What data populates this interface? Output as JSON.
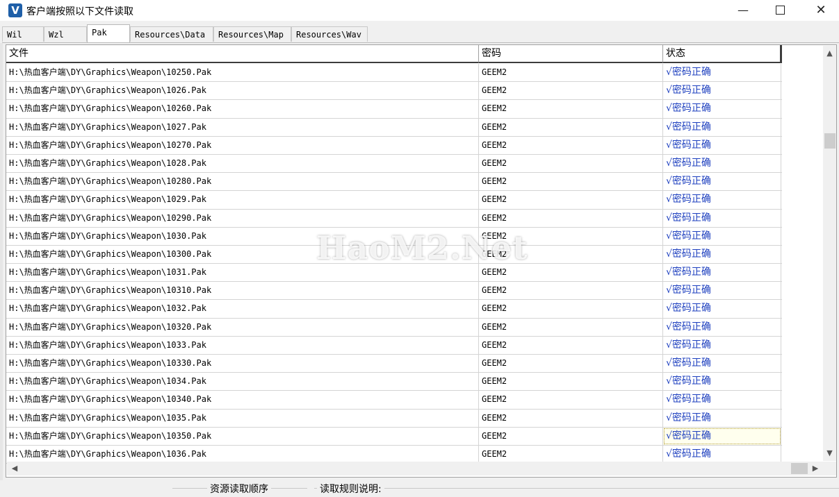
{
  "window": {
    "title": "客户端按照以下文件读取",
    "icon_letter": "V",
    "minimize": "—",
    "close": "✕"
  },
  "tabs": [
    {
      "label": "Wil",
      "active": false
    },
    {
      "label": "Wzl",
      "active": false
    },
    {
      "label": "Pak",
      "active": true
    },
    {
      "label": "Resources\\Data",
      "active": false
    },
    {
      "label": "Resources\\Map",
      "active": false
    },
    {
      "label": "Resources\\Wav",
      "active": false
    }
  ],
  "table": {
    "columns": [
      "文件",
      "密码",
      "状态"
    ],
    "rows": [
      {
        "file": "H:\\热血客户端\\DY\\Graphics\\Weapon\\10250.Pak",
        "password": "GEEM2",
        "status": "√密码正确"
      },
      {
        "file": "H:\\热血客户端\\DY\\Graphics\\Weapon\\1026.Pak",
        "password": "GEEM2",
        "status": "√密码正确"
      },
      {
        "file": "H:\\热血客户端\\DY\\Graphics\\Weapon\\10260.Pak",
        "password": "GEEM2",
        "status": "√密码正确"
      },
      {
        "file": "H:\\热血客户端\\DY\\Graphics\\Weapon\\1027.Pak",
        "password": "GEEM2",
        "status": "√密码正确"
      },
      {
        "file": "H:\\热血客户端\\DY\\Graphics\\Weapon\\10270.Pak",
        "password": "GEEM2",
        "status": "√密码正确"
      },
      {
        "file": "H:\\热血客户端\\DY\\Graphics\\Weapon\\1028.Pak",
        "password": "GEEM2",
        "status": "√密码正确"
      },
      {
        "file": "H:\\热血客户端\\DY\\Graphics\\Weapon\\10280.Pak",
        "password": "GEEM2",
        "status": "√密码正确"
      },
      {
        "file": "H:\\热血客户端\\DY\\Graphics\\Weapon\\1029.Pak",
        "password": "GEEM2",
        "status": "√密码正确"
      },
      {
        "file": "H:\\热血客户端\\DY\\Graphics\\Weapon\\10290.Pak",
        "password": "GEEM2",
        "status": "√密码正确"
      },
      {
        "file": "H:\\热血客户端\\DY\\Graphics\\Weapon\\1030.Pak",
        "password": "GEEM2",
        "status": "√密码正确"
      },
      {
        "file": "H:\\热血客户端\\DY\\Graphics\\Weapon\\10300.Pak",
        "password": "GEEM2",
        "status": "√密码正确"
      },
      {
        "file": "H:\\热血客户端\\DY\\Graphics\\Weapon\\1031.Pak",
        "password": "GEEM2",
        "status": "√密码正确"
      },
      {
        "file": "H:\\热血客户端\\DY\\Graphics\\Weapon\\10310.Pak",
        "password": "GEEM2",
        "status": "√密码正确"
      },
      {
        "file": "H:\\热血客户端\\DY\\Graphics\\Weapon\\1032.Pak",
        "password": "GEEM2",
        "status": "√密码正确"
      },
      {
        "file": "H:\\热血客户端\\DY\\Graphics\\Weapon\\10320.Pak",
        "password": "GEEM2",
        "status": "√密码正确"
      },
      {
        "file": "H:\\热血客户端\\DY\\Graphics\\Weapon\\1033.Pak",
        "password": "GEEM2",
        "status": "√密码正确"
      },
      {
        "file": "H:\\热血客户端\\DY\\Graphics\\Weapon\\10330.Pak",
        "password": "GEEM2",
        "status": "√密码正确"
      },
      {
        "file": "H:\\热血客户端\\DY\\Graphics\\Weapon\\1034.Pak",
        "password": "GEEM2",
        "status": "√密码正确"
      },
      {
        "file": "H:\\热血客户端\\DY\\Graphics\\Weapon\\10340.Pak",
        "password": "GEEM2",
        "status": "√密码正确"
      },
      {
        "file": "H:\\热血客户端\\DY\\Graphics\\Weapon\\1035.Pak",
        "password": "GEEM2",
        "status": "√密码正确"
      },
      {
        "file": "H:\\热血客户端\\DY\\Graphics\\Weapon\\10350.Pak",
        "password": "GEEM2",
        "status": "√密码正确",
        "selected": true
      },
      {
        "file": "H:\\热血客户端\\DY\\Graphics\\Weapon\\1036.Pak",
        "password": "GEEM2",
        "status": "√密码正确"
      }
    ]
  },
  "bottom": {
    "group1_label": "资源读取顺序",
    "group2_label": "读取规则说明:"
  },
  "watermark": "HaoM2.Net",
  "icons": {
    "scroll_up": "▲",
    "scroll_down": "▼",
    "scroll_left": "◀",
    "scroll_right": "▶"
  },
  "colors": {
    "status_text": "#1d3fbf",
    "app_icon": "#1f5fa8"
  }
}
